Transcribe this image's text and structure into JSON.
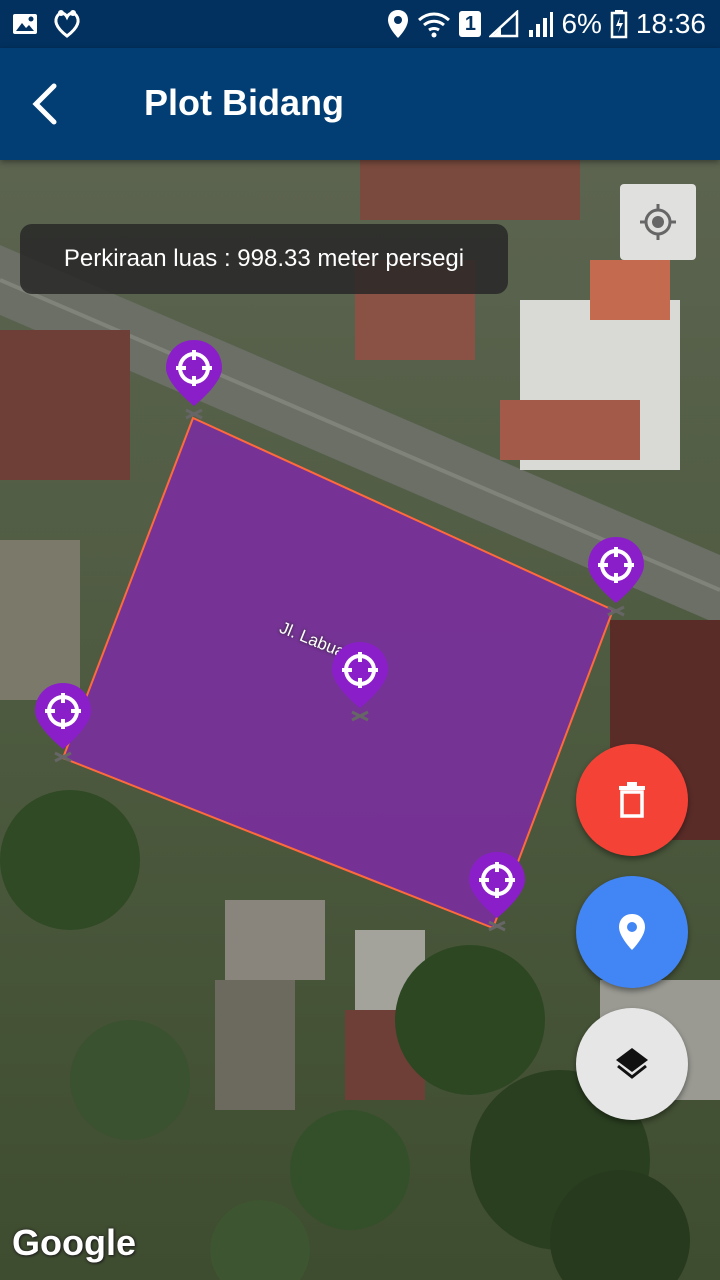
{
  "status_bar": {
    "sim_badge": "1",
    "battery": "6%",
    "time": "18:36"
  },
  "app_bar": {
    "title": "Plot Bidang"
  },
  "map": {
    "area_estimate": "Perkiraan luas : 998.33 meter persegi",
    "road_label": "Jl. Labuansait",
    "attribution": "Google",
    "plot_fill_color": "#7b2da0",
    "plot_outline_color": "#ff6a3d",
    "marker_color": "#8a1fc9"
  },
  "fabs": {
    "delete_color": "#f44336",
    "add_point_color": "#4285f4",
    "layers_color": "#e6e6e6"
  }
}
